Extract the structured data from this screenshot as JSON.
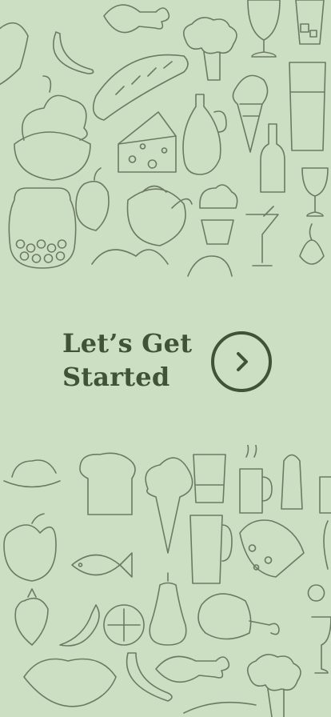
{
  "hero": {
    "title_line1": "Let’s Get",
    "title_line2": "Started"
  },
  "cta": {
    "icon": "chevron-right-icon",
    "color": "#3f5335"
  },
  "theme": {
    "background": "#cddfc3",
    "illustration_stroke": "#6c7a62"
  }
}
